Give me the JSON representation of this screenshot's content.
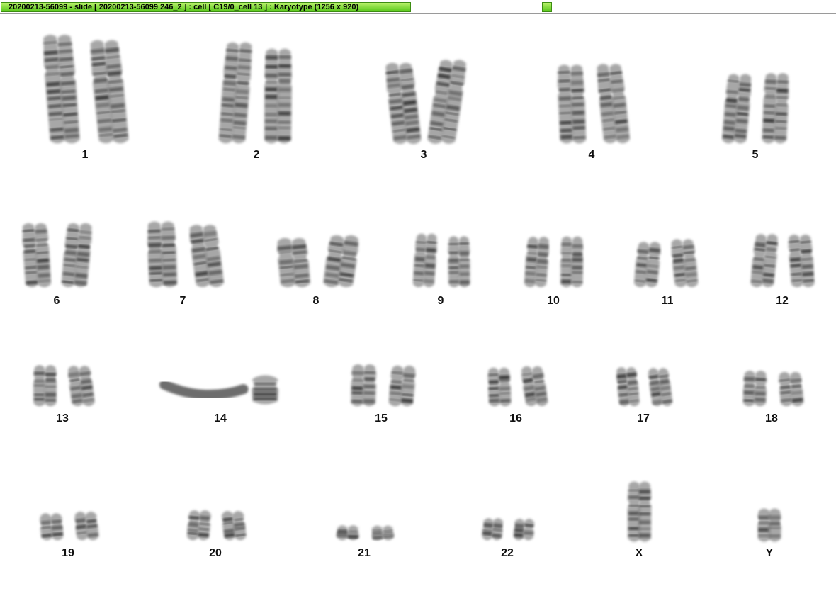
{
  "window": {
    "title": "20200213-56099 - slide [ 20200213-56099 246_2 ] : cell [ C19/0_cell 13 ] : Karyotype  (1256 x 920)"
  },
  "karyogram": {
    "chromosomes": [
      {
        "label": "1"
      },
      {
        "label": "2"
      },
      {
        "label": "3"
      },
      {
        "label": "4"
      },
      {
        "label": "5"
      },
      {
        "label": "6"
      },
      {
        "label": "7"
      },
      {
        "label": "8"
      },
      {
        "label": "9"
      },
      {
        "label": "10"
      },
      {
        "label": "11"
      },
      {
        "label": "12"
      },
      {
        "label": "13"
      },
      {
        "label": "14"
      },
      {
        "label": "15"
      },
      {
        "label": "16"
      },
      {
        "label": "17"
      },
      {
        "label": "18"
      },
      {
        "label": "19"
      },
      {
        "label": "20"
      },
      {
        "label": "21"
      },
      {
        "label": "22"
      },
      {
        "label": "X"
      },
      {
        "label": "Y"
      }
    ]
  }
}
